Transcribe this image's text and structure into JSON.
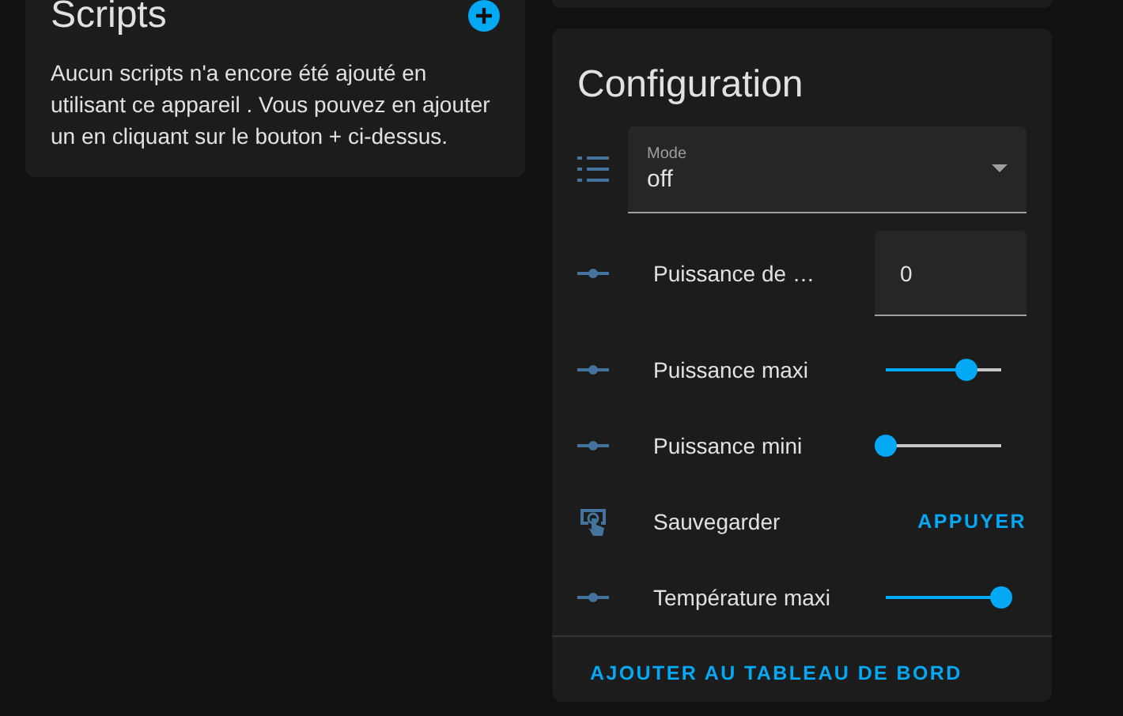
{
  "scripts_card": {
    "title": "Scripts",
    "message": "Aucun scripts n'a encore été ajouté en utilisant ce appareil . Vous pouvez en ajouter un en cliquant sur le bouton + ci-dessus."
  },
  "configuration": {
    "title": "Configuration",
    "rows": [
      {
        "kind": "select",
        "label": "Mode",
        "value": "off"
      },
      {
        "kind": "number",
        "label": "Puissance de …",
        "value": "0"
      },
      {
        "kind": "slider",
        "label": "Puissance maxi",
        "level": 0.7
      },
      {
        "kind": "slider",
        "label": "Puissance mini",
        "level": 0
      },
      {
        "kind": "button",
        "label": "Sauvegarder",
        "action": "APPUYER"
      },
      {
        "kind": "slider",
        "label": "Température maxi",
        "level": 1
      }
    ],
    "footer_action": "AJOUTER AU TABLEAU DE BORD"
  }
}
